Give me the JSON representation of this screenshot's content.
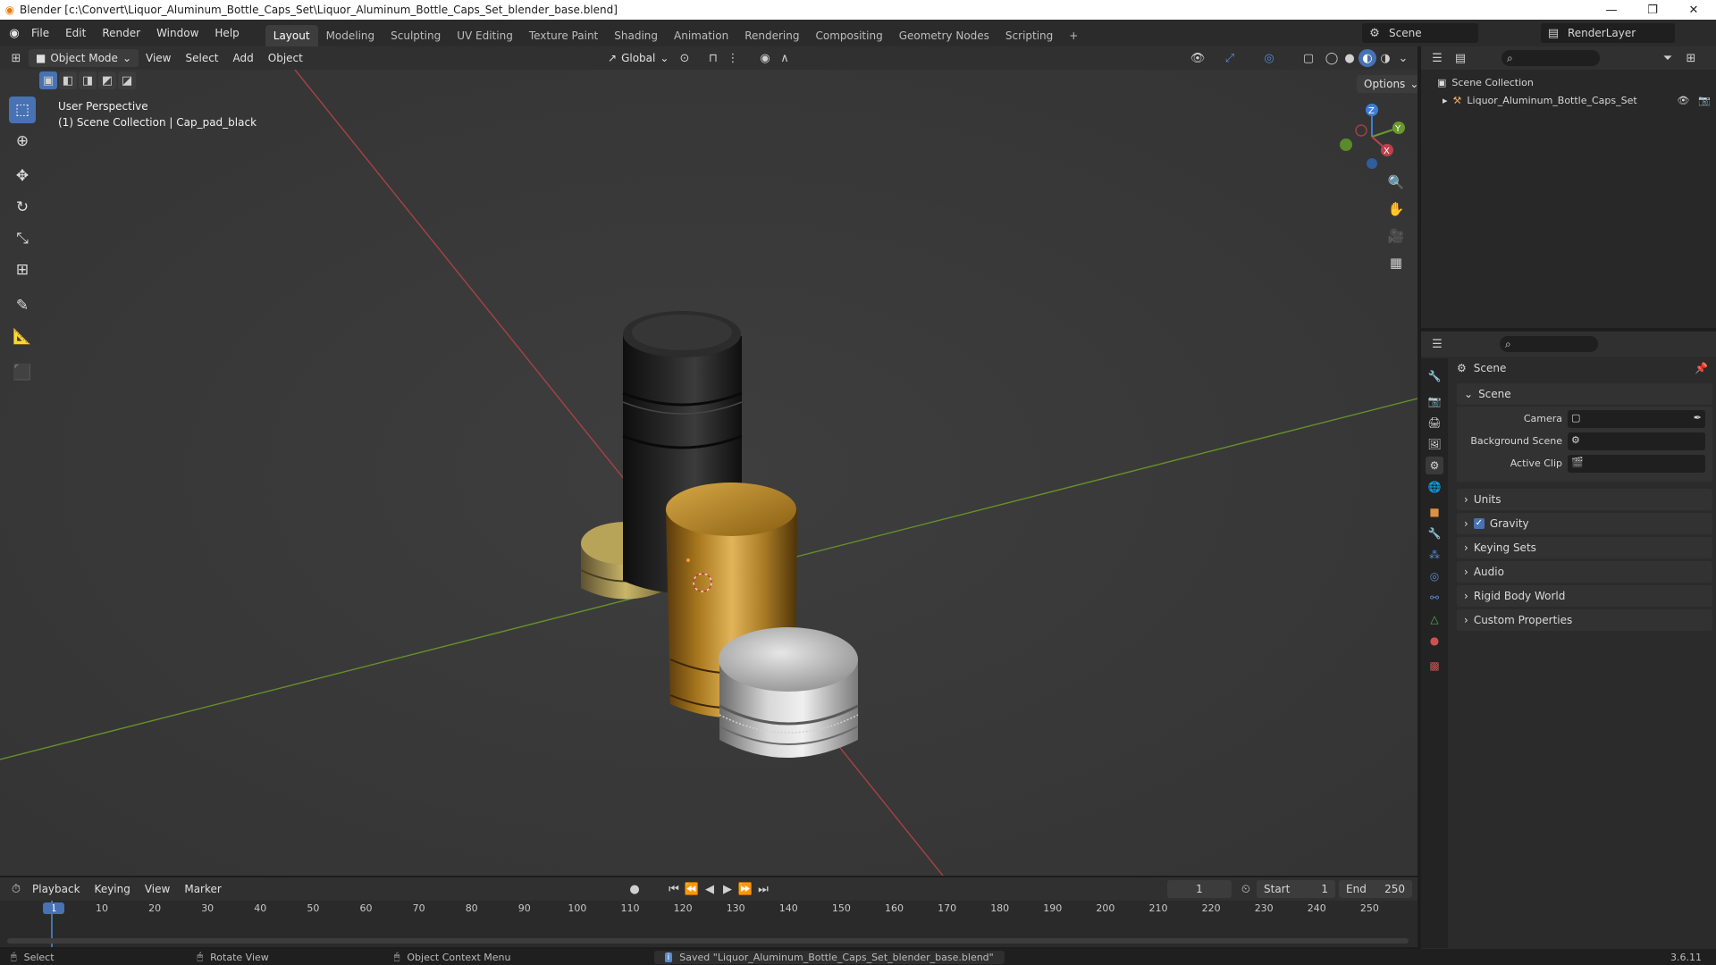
{
  "window": {
    "title": "Blender [c:\\Convert\\Liquor_Aluminum_Bottle_Caps_Set\\Liquor_Aluminum_Bottle_Caps_Set_blender_base.blend]",
    "controls": [
      "—",
      "❐",
      "✕"
    ]
  },
  "menu": [
    "File",
    "Edit",
    "Render",
    "Window",
    "Help"
  ],
  "workspaces": [
    "Layout",
    "Modeling",
    "Sculpting",
    "UV Editing",
    "Texture Paint",
    "Shading",
    "Animation",
    "Rendering",
    "Compositing",
    "Geometry Nodes",
    "Scripting"
  ],
  "workspace_add": "+",
  "active_workspace": "Layout",
  "scene_selector": "Scene",
  "view_layer": "RenderLayer",
  "viewport": {
    "mode": "Object Mode",
    "menus": [
      "View",
      "Select",
      "Add",
      "Object"
    ],
    "orientation": "Global",
    "options": "Options",
    "info_line1": "User Perspective",
    "info_line2": "(1) Scene Collection | Cap_pad_black",
    "gizmo_labels": {
      "x": "X",
      "y": "Y",
      "z": "Z"
    }
  },
  "tools": [
    "select-box",
    "cursor",
    "move",
    "rotate",
    "scale",
    "transform",
    "annotate",
    "measure",
    "add-cube"
  ],
  "outliner": {
    "root": "Scene Collection",
    "items": [
      {
        "label": "Liquor_Aluminum_Bottle_Caps_Set"
      }
    ]
  },
  "properties": {
    "header": "Scene",
    "section": "Scene",
    "fields": [
      {
        "label": "Camera",
        "value": ""
      },
      {
        "label": "Background Scene",
        "value": ""
      },
      {
        "label": "Active Clip",
        "value": ""
      }
    ],
    "subpanels": [
      "Units",
      "Gravity",
      "Keying Sets",
      "Audio",
      "Rigid Body World",
      "Custom Properties"
    ],
    "gravity_enabled": true
  },
  "timeline": {
    "menus": [
      "Playback",
      "Keying",
      "View",
      "Marker"
    ],
    "current_frame": "1",
    "start_label": "Start",
    "start": "1",
    "end_label": "End",
    "end": "250",
    "ticks": [
      "1",
      "10",
      "20",
      "30",
      "40",
      "50",
      "60",
      "70",
      "80",
      "90",
      "100",
      "110",
      "120",
      "130",
      "140",
      "150",
      "160",
      "170",
      "180",
      "190",
      "200",
      "210",
      "220",
      "230",
      "240",
      "250"
    ]
  },
  "status": {
    "select": "Select",
    "rotate": "Rotate View",
    "context": "Object Context Menu",
    "message": "Saved \"Liquor_Aluminum_Bottle_Caps_Set_blender_base.blend\"",
    "version": "3.6.11"
  },
  "colors": {
    "accent": "#4772b3",
    "x_axis": "#c0404a",
    "y_axis": "#6a9a2a",
    "z_axis": "#3d7fd0",
    "gold": "#b68a2c",
    "silver": "#b8b8b8",
    "black_cap": "#1b1b1b"
  }
}
